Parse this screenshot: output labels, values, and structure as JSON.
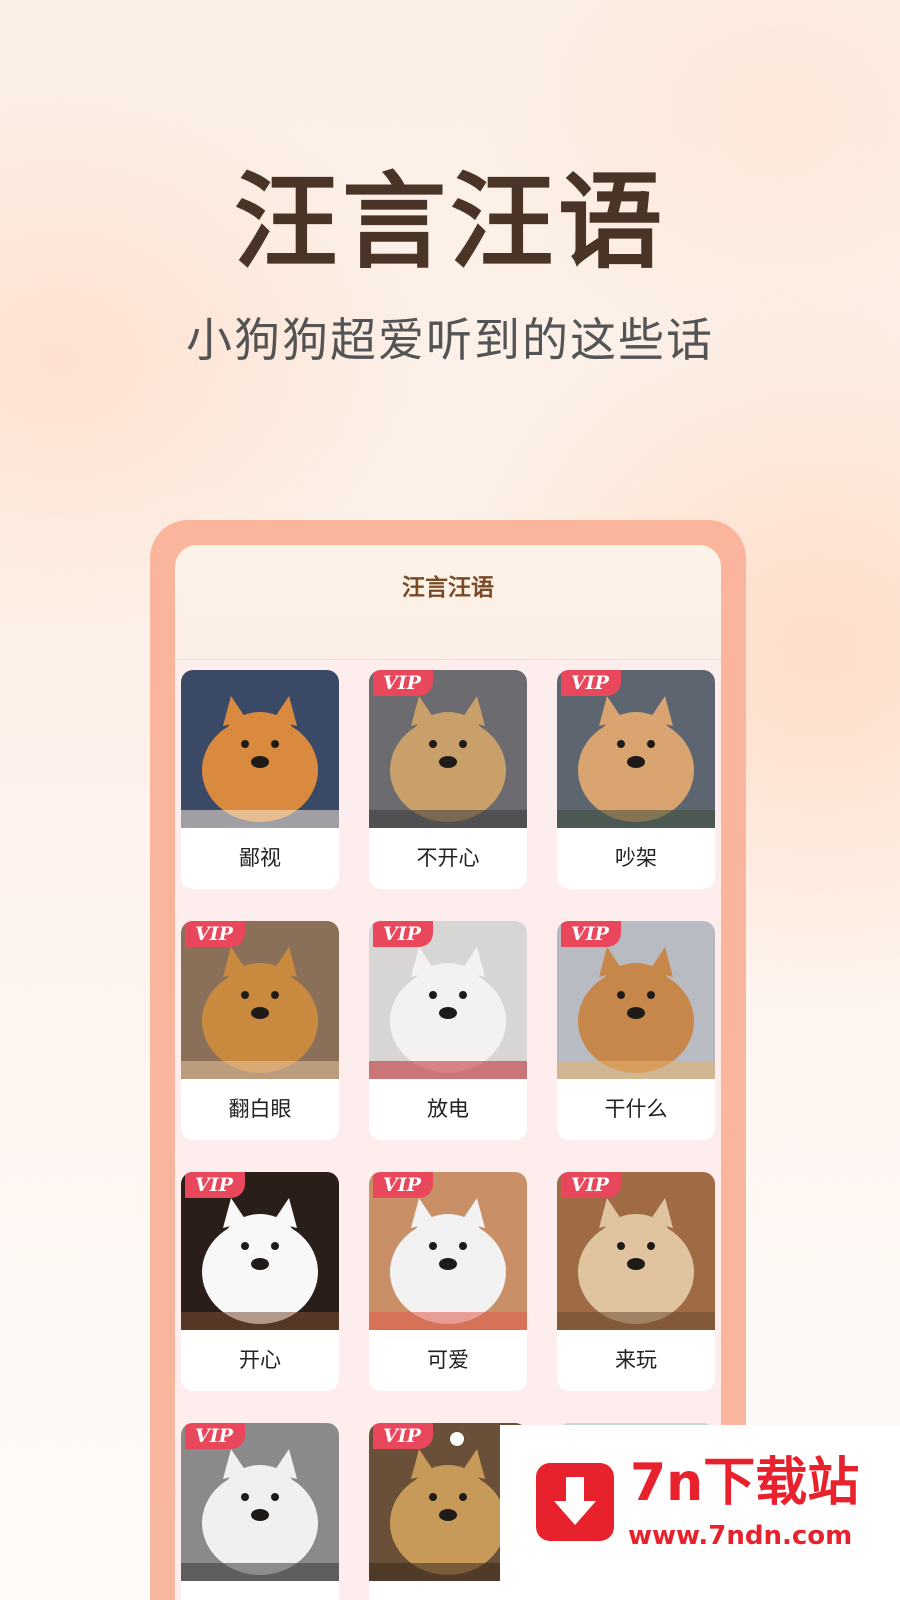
{
  "hero": {
    "title": "汪言汪语",
    "subtitle": "小狗狗超爱听到的这些话"
  },
  "app": {
    "title": "汪言汪语",
    "cards": [
      {
        "label": "鄙视",
        "vip": false,
        "badge": "",
        "image": "shiba-dog-photo",
        "colors": [
          "#3a4a66",
          "#d98a3f",
          "#f4e6d6"
        ]
      },
      {
        "label": "不开心",
        "vip": true,
        "badge": "VIP",
        "image": "pug-on-sofa-photo",
        "colors": [
          "#6c6c70",
          "#c9a06a",
          "#3b3b3d"
        ]
      },
      {
        "label": "吵架",
        "vip": true,
        "badge": "VIP",
        "image": "spaniel-puppy-photo",
        "colors": [
          "#5d6670",
          "#d9a470",
          "#3e4d3a"
        ]
      },
      {
        "label": "翻白眼",
        "vip": true,
        "badge": "VIP",
        "image": "corgi-eye-roll-photo",
        "colors": [
          "#8a7058",
          "#c98a40",
          "#e3c39c"
        ]
      },
      {
        "label": "放电",
        "vip": true,
        "badge": "VIP",
        "image": "white-dog-rose-photo",
        "colors": [
          "#d8d6d4",
          "#f4f2f0",
          "#c0282e"
        ]
      },
      {
        "label": "干什么",
        "vip": true,
        "badge": "VIP",
        "image": "shiba-cookie-photo",
        "colors": [
          "#b8bcc2",
          "#c8874a",
          "#e6b070"
        ]
      },
      {
        "label": "开心",
        "vip": true,
        "badge": "VIP",
        "image": "pomeranian-photo",
        "colors": [
          "#2a1e18",
          "#f8f8f8",
          "#7a4a32"
        ]
      },
      {
        "label": "可爱",
        "vip": true,
        "badge": "VIP",
        "image": "puppy-in-teacup-photo",
        "colors": [
          "#c99068",
          "#f2f2f2",
          "#e05a4a"
        ]
      },
      {
        "label": "来玩",
        "vip": true,
        "badge": "VIP",
        "image": "shiba-family-photo",
        "colors": [
          "#a06a45",
          "#e0c4a0",
          "#6b4a30"
        ]
      },
      {
        "label": "",
        "vip": true,
        "badge": "VIP",
        "image": "husky-photo",
        "colors": [
          "#8a8a8a",
          "#f0f0f0",
          "#3a3a3a"
        ]
      },
      {
        "label": "",
        "vip": true,
        "badge": "VIP",
        "image": "labrador-photo",
        "colors": [
          "#6a5038",
          "#c89a5a",
          "#3a2a1e"
        ]
      },
      {
        "label": "",
        "vip": true,
        "badge": "",
        "image": "dog-photo",
        "colors": [
          "#c8d4e0",
          "#e6e6e6",
          "#9aa6b2"
        ]
      }
    ]
  },
  "watermark": {
    "brand": "7n下载站",
    "url": "www.7ndn.com",
    "icon": "download-arrow-icon",
    "color": "#e8222d"
  }
}
